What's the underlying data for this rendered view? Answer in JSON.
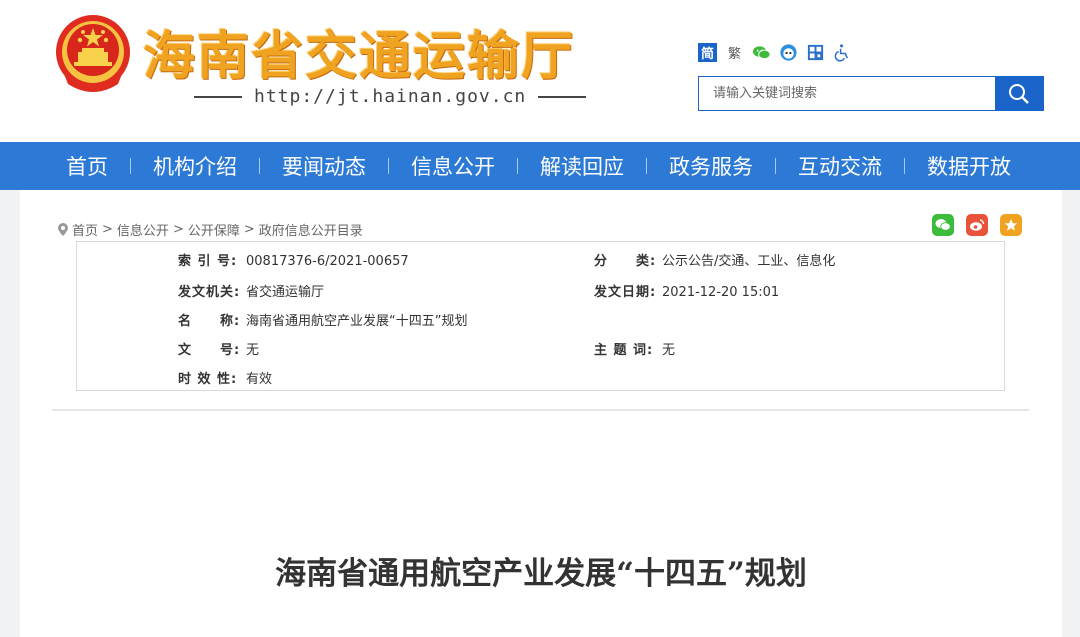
{
  "site": {
    "name": "海南省交通运输厅",
    "url": "http://jt.hainan.gov.cn"
  },
  "tools": {
    "simplified": "简",
    "traditional": "繁"
  },
  "search": {
    "placeholder": "请输入关键词搜索"
  },
  "nav": {
    "items": [
      "首页",
      "机构介绍",
      "要闻动态",
      "信息公开",
      "解读回应",
      "政务服务",
      "互动交流",
      "数据开放"
    ]
  },
  "breadcrumb": [
    "首页",
    "信息公开",
    "公开保障",
    "政府信息公开目录"
  ],
  "meta": {
    "index_label": "索 引 号:",
    "index_value": "00817376-6/2021-00657",
    "category_label": "分　　类:",
    "category_value": "公示公告/交通、工业、信息化",
    "issuer_label": "发文机关:",
    "issuer_value": "省交通运输厅",
    "date_label": "发文日期:",
    "date_value": "2021-12-20 15:01",
    "name_label": "名　　称:",
    "name_value": "海南省通用航空产业发展“十四五”规划",
    "docno_label": "文　　号:",
    "docno_value": "无",
    "keywords_label": "主 题 词:",
    "keywords_value": "无",
    "validity_label": "时 效 性:",
    "validity_value": "有效"
  },
  "doc": {
    "title": "海南省通用航空产业发展“十四五”规划"
  },
  "colors": {
    "primary": "#2c7ad6",
    "title_orange": "#f0a320",
    "wechat": "#3dbb3a",
    "weibo": "#e8533a",
    "star": "#f0a320"
  }
}
